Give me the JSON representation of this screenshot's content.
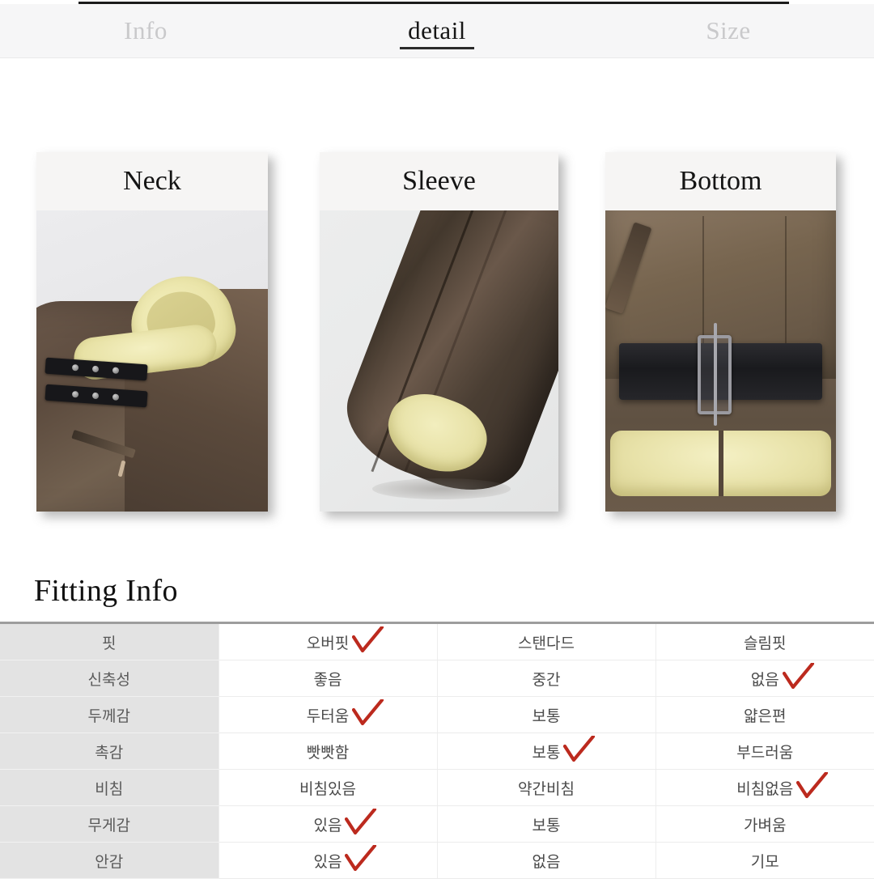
{
  "tabs": [
    {
      "label": "Info",
      "active": false
    },
    {
      "label": "detail",
      "active": true
    },
    {
      "label": "Size",
      "active": false
    }
  ],
  "detail_cards": [
    {
      "title": "Neck",
      "photo": "neck-closeup-photo"
    },
    {
      "title": "Sleeve",
      "photo": "sleeve-closeup-photo"
    },
    {
      "title": "Bottom",
      "photo": "bottom-closeup-photo"
    }
  ],
  "fitting": {
    "heading": "Fitting Info",
    "check_color": "#bc2a1e",
    "rows": [
      {
        "label": "핏",
        "options": [
          {
            "text": "오버핏",
            "checked": true
          },
          {
            "text": "스탠다드",
            "checked": false
          },
          {
            "text": "슬림핏",
            "checked": false
          }
        ]
      },
      {
        "label": "신축성",
        "options": [
          {
            "text": "좋음",
            "checked": false
          },
          {
            "text": "중간",
            "checked": false
          },
          {
            "text": "없음",
            "checked": true
          }
        ]
      },
      {
        "label": "두께감",
        "options": [
          {
            "text": "두터움",
            "checked": true
          },
          {
            "text": "보통",
            "checked": false
          },
          {
            "text": "얇은편",
            "checked": false
          }
        ]
      },
      {
        "label": "촉감",
        "options": [
          {
            "text": "빳빳함",
            "checked": false
          },
          {
            "text": "보통",
            "checked": true
          },
          {
            "text": "부드러움",
            "checked": false
          }
        ]
      },
      {
        "label": "비침",
        "options": [
          {
            "text": "비침있음",
            "checked": false
          },
          {
            "text": "약간비침",
            "checked": false
          },
          {
            "text": "비침없음",
            "checked": true
          }
        ]
      },
      {
        "label": "무게감",
        "options": [
          {
            "text": "있음",
            "checked": true
          },
          {
            "text": "보통",
            "checked": false
          },
          {
            "text": "가벼움",
            "checked": false
          }
        ]
      },
      {
        "label": "안감",
        "options": [
          {
            "text": "있음",
            "checked": true
          },
          {
            "text": "없음",
            "checked": false
          },
          {
            "text": "기모",
            "checked": false
          }
        ]
      }
    ]
  }
}
